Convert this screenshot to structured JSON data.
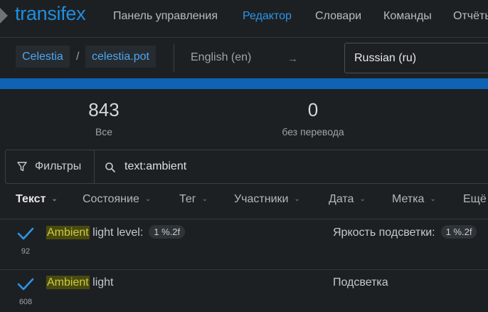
{
  "nav": {
    "logo": "transifex",
    "items": [
      "Панель управления",
      "Редактор",
      "Словари",
      "Команды",
      "Отчёты"
    ],
    "active_index": 1
  },
  "breadcrumb": {
    "project": "Celestia",
    "separator": "/",
    "resource": "celestia.pot"
  },
  "languages": {
    "source": "English (en)",
    "arrow": "→",
    "target": "Russian (ru)"
  },
  "progress": {
    "translated_fraction": 1.0,
    "color": "#0f63b5"
  },
  "stats": [
    {
      "value": "843",
      "label": "Все"
    },
    {
      "value": "0",
      "label": "без перевода"
    }
  ],
  "filter": {
    "button_label": "Фильтры",
    "search_value": "text:ambient"
  },
  "columns": [
    "Текст",
    "Состояние",
    "Тег",
    "Участники",
    "Дата",
    "Метка",
    "Ещё"
  ],
  "rows": [
    {
      "number": "92",
      "source_highlight": "Ambient",
      "source_rest": " light level:",
      "source_placeholder": "1 %.2f",
      "translation": "Яркость подсветки:",
      "translation_placeholder": "1 %.2f",
      "status": "check"
    },
    {
      "number": "608",
      "source_highlight": "Ambient",
      "source_rest": " light",
      "translation": "Подсветка",
      "status": "check"
    }
  ],
  "colors": {
    "accent": "#2d95e8",
    "highlight_bg": "#4a4a0f",
    "check": "#2d95e8"
  }
}
